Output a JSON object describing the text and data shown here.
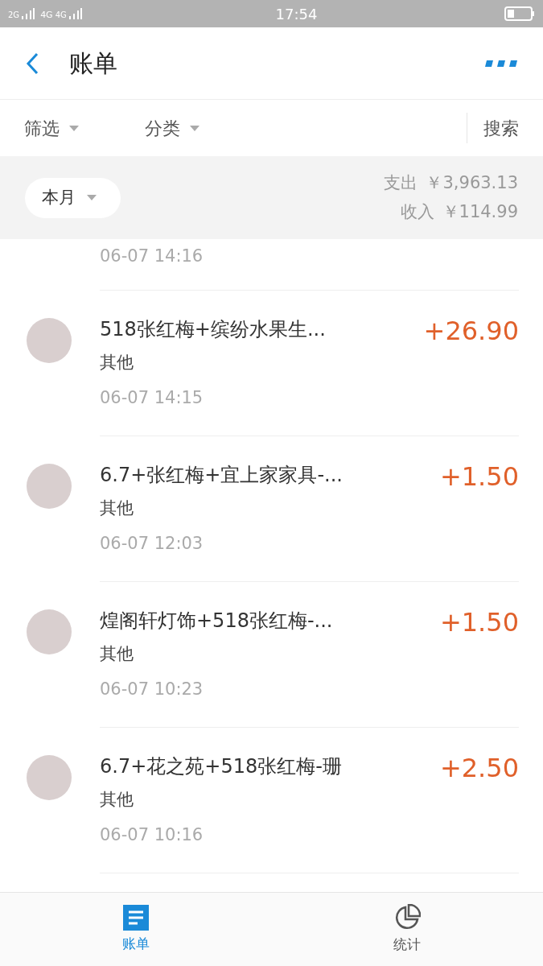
{
  "status_bar": {
    "network_1": "2G",
    "network_2": "4G",
    "network_3": "4G",
    "time": "17:54"
  },
  "header": {
    "title": "账单"
  },
  "filters": [
    {
      "label": "筛选",
      "kind": "dropdown"
    },
    {
      "label": "分类",
      "kind": "dropdown"
    },
    {
      "label": "搜索",
      "kind": "link"
    }
  ],
  "summary": {
    "period": "本月",
    "expense_label": "支出",
    "expense": "￥3,963.13",
    "income_label": "收入",
    "income": "￥114.99"
  },
  "partial_row": {
    "time": "06-07  14:16"
  },
  "transactions": [
    {
      "title": "518张红梅+缤纷水果生...",
      "category": "其他",
      "time": "06-07  14:15",
      "amount": "+26.90"
    },
    {
      "title": "6.7+张红梅+宜上家家具-...",
      "category": "其他",
      "time": "06-07  12:03",
      "amount": "+1.50"
    },
    {
      "title": "煌阁轩灯饰+518张红梅-...",
      "category": "其他",
      "time": "06-07  10:23",
      "amount": "+1.50"
    },
    {
      "title": "6.7+花之苑+518张红梅-珊",
      "category": "其他",
      "time": "06-07  10:16",
      "amount": "+2.50"
    }
  ],
  "tab_bar": [
    {
      "label": "账单",
      "selected": true,
      "kind": "list"
    },
    {
      "label": "统计",
      "selected": false,
      "kind": "chart"
    }
  ]
}
